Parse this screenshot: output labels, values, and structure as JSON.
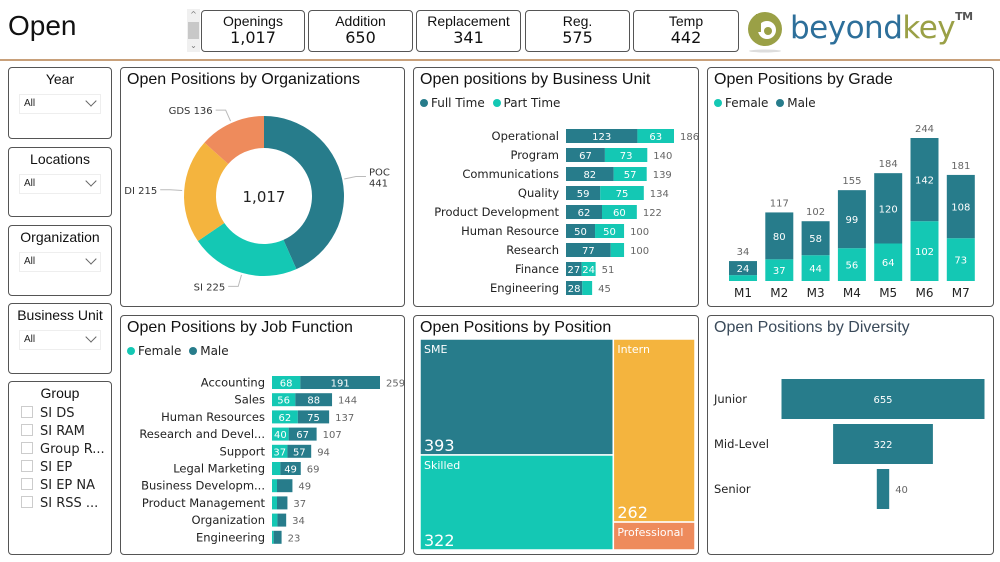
{
  "page": {
    "title": "Open"
  },
  "colors": {
    "teal_dark": "#277c8b",
    "teal_light": "#14c8b4",
    "orange_yellow": "#f4b43e",
    "salmon": "#ee8b5c",
    "header_rule": "#c8a07a"
  },
  "kpis": [
    {
      "label": "Openings",
      "value": "1,017"
    },
    {
      "label": "Addition",
      "value": "650"
    },
    {
      "label": "Replacement",
      "value": "341"
    },
    {
      "label": "Reg.",
      "value": "575"
    },
    {
      "label": "Temp",
      "value": "442"
    }
  ],
  "logo": {
    "part1": "beyond",
    "part2": "key",
    "tm": "TM"
  },
  "slicers": {
    "year": {
      "title": "Year",
      "value": "All"
    },
    "locations": {
      "title": "Locations",
      "value": "All"
    },
    "organization": {
      "title": "Organization",
      "value": "All"
    },
    "business_unit": {
      "title": "Business Unit",
      "value": "All"
    },
    "group": {
      "title": "Group",
      "items": [
        "SI DS",
        "SI RAM",
        "Group R...",
        "SI EP",
        "SI EP NA",
        "SI RSS ..."
      ]
    }
  },
  "chart_data": [
    {
      "id": "org",
      "type": "pie",
      "title": "Open Positions by Organizations",
      "donut": true,
      "center_label": "1,017",
      "slices": [
        {
          "label": "POC",
          "value": 441,
          "color": "#277c8b"
        },
        {
          "label": "SI",
          "value": 225,
          "color": "#14c8b4"
        },
        {
          "label": "DI",
          "value": 215,
          "color": "#f4b43e"
        },
        {
          "label": "GDS",
          "value": 136,
          "color": "#ee8b5c"
        }
      ]
    },
    {
      "id": "bu",
      "type": "bar",
      "orientation": "horizontal",
      "stacked": true,
      "title": "Open positions by Business Unit",
      "legend": [
        {
          "name": "Full Time",
          "color": "#277c8b"
        },
        {
          "name": "Part Time",
          "color": "#14c8b4"
        }
      ],
      "categories": [
        "Operational",
        "Program",
        "Communications",
        "Quality",
        "Product Development",
        "Human Resource",
        "Research",
        "Finance",
        "Engineering"
      ],
      "series": [
        {
          "name": "Full Time",
          "values": [
            123,
            67,
            82,
            59,
            62,
            50,
            77,
            27,
            28
          ],
          "show_labels": [
            true,
            true,
            true,
            true,
            true,
            true,
            true,
            true,
            true
          ]
        },
        {
          "name": "Part Time",
          "values": [
            63,
            73,
            57,
            75,
            60,
            50,
            23,
            24,
            17
          ],
          "show_labels": [
            true,
            true,
            true,
            true,
            true,
            true,
            false,
            true,
            false
          ]
        }
      ],
      "totals": [
        186,
        140,
        139,
        134,
        122,
        100,
        100,
        51,
        45
      ]
    },
    {
      "id": "grade",
      "type": "bar",
      "orientation": "vertical",
      "stacked": true,
      "title": "Open Positions by Grade",
      "legend": [
        {
          "name": "Female",
          "color": "#14c8b4"
        },
        {
          "name": "Male",
          "color": "#277c8b"
        }
      ],
      "categories": [
        "M1",
        "M2",
        "M3",
        "M4",
        "M5",
        "M6",
        "M7"
      ],
      "series": [
        {
          "name": "Female",
          "values": [
            10,
            37,
            44,
            56,
            64,
            102,
            73
          ],
          "show_labels": [
            false,
            true,
            true,
            true,
            true,
            true,
            true
          ]
        },
        {
          "name": "Male",
          "values": [
            24,
            80,
            58,
            99,
            120,
            142,
            108
          ],
          "show_labels": [
            true,
            true,
            true,
            true,
            true,
            true,
            true
          ]
        }
      ],
      "totals": [
        34,
        117,
        102,
        155,
        184,
        244,
        181
      ]
    },
    {
      "id": "job",
      "type": "bar",
      "orientation": "horizontal",
      "stacked": true,
      "title": "Open Positions by Job Function",
      "legend": [
        {
          "name": "Female",
          "color": "#14c8b4"
        },
        {
          "name": "Male",
          "color": "#277c8b"
        }
      ],
      "categories": [
        "Accounting",
        "Sales",
        "Human Resources",
        "Research and Devel...",
        "Support",
        "Legal Marketing",
        "Business Developm...",
        "Product Management",
        "Organization",
        "Engineering"
      ],
      "series": [
        {
          "name": "Female",
          "values": [
            68,
            56,
            62,
            40,
            37,
            20,
            12,
            12,
            13,
            4
          ],
          "show_labels": [
            true,
            true,
            true,
            true,
            true,
            false,
            false,
            false,
            false,
            false
          ]
        },
        {
          "name": "Male",
          "values": [
            191,
            88,
            75,
            67,
            57,
            49,
            37,
            25,
            21,
            19
          ],
          "show_labels": [
            true,
            true,
            true,
            true,
            true,
            true,
            false,
            false,
            false,
            false
          ]
        }
      ],
      "totals": [
        259,
        144,
        137,
        107,
        94,
        69,
        49,
        37,
        34,
        23
      ]
    },
    {
      "id": "position",
      "type": "treemap",
      "title": "Open Positions by Position",
      "items": [
        {
          "label": "SME",
          "value": 393,
          "color": "#277c8b",
          "show_value": true
        },
        {
          "label": "Skilled",
          "value": 322,
          "color": "#14c8b4",
          "show_value": true
        },
        {
          "label": "Intern",
          "value": 262,
          "color": "#f4b43e",
          "show_value": true
        },
        {
          "label": "Professional",
          "value": 40,
          "color": "#ee8b5c",
          "show_value": false
        }
      ]
    },
    {
      "id": "diversity",
      "type": "bar",
      "subtype": "funnel",
      "title": "Open Positions by Diversity",
      "categories": [
        "Junior",
        "Mid-Level",
        "Senior"
      ],
      "values": [
        655,
        322,
        40
      ],
      "color": "#277c8b"
    }
  ]
}
